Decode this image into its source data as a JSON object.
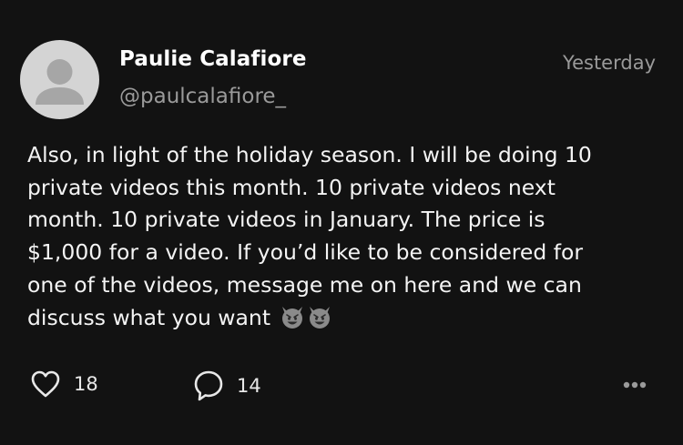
{
  "author": {
    "name": "Paulie Calafiore",
    "handle": "@paulcalafiore_"
  },
  "timestamp": "Yesterday",
  "post": {
    "lines": [
      "Also, in light of the holiday season. I will be doing 10",
      "private videos this month. 10 private videos next",
      "month. 10 private videos in January. The price is",
      "$1,000 for a video. If you’d like to be considered for",
      "one of the videos, message me on here and we can",
      "discuss what you want"
    ],
    "emojis": [
      "smiling-devil-emoji",
      "smiling-devil-emoji"
    ]
  },
  "actions": {
    "like_count": "18",
    "comment_count": "14"
  },
  "icons": {
    "like": "heart-icon",
    "comment": "speech-bubble-icon",
    "more": "more-dots-icon",
    "avatar": "default-avatar-icon"
  },
  "colors": {
    "background": "#121212",
    "text_primary": "#ffffff",
    "text_secondary": "#9a9a9a",
    "avatar_bg": "#d4d4d4",
    "avatar_silhouette": "#a6a6a6"
  }
}
